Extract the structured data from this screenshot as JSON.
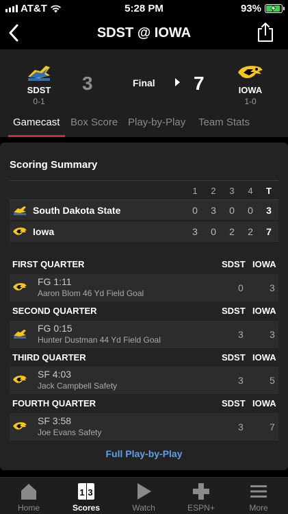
{
  "status_bar": {
    "carrier": "AT&T",
    "time": "5:28 PM",
    "battery": "93%",
    "battery_level": 0.93
  },
  "nav": {
    "title": "SDST @ IOWA"
  },
  "game": {
    "away": {
      "abbr": "SDST",
      "record": "0-1",
      "score": "3"
    },
    "home": {
      "abbr": "IOWA",
      "record": "1-0",
      "score": "7"
    },
    "status": "Final"
  },
  "tabs": [
    "Gamecast",
    "Box Score",
    "Play-by-Play",
    "Team Stats"
  ],
  "scoring_summary": {
    "title": "Scoring Summary",
    "columns": [
      "1",
      "2",
      "3",
      "4",
      "T"
    ],
    "teams": [
      {
        "name": "South Dakota State",
        "q": [
          "0",
          "3",
          "0",
          "0"
        ],
        "total": "3"
      },
      {
        "name": "Iowa",
        "q": [
          "3",
          "0",
          "2",
          "2"
        ],
        "total": "7"
      }
    ]
  },
  "quarters": [
    {
      "label": "FIRST QUARTER",
      "away": "SDST",
      "home": "IOWA",
      "play": {
        "team": "IOWA",
        "type_time": "FG  1:11",
        "desc": "Aaron Blom 46 Yd Field Goal",
        "away_score": "0",
        "home_score": "3"
      }
    },
    {
      "label": "SECOND QUARTER",
      "away": "SDST",
      "home": "IOWA",
      "play": {
        "team": "SDST",
        "type_time": "FG  0:15",
        "desc": "Hunter Dustman 44 Yd Field Goal",
        "away_score": "3",
        "home_score": "3"
      }
    },
    {
      "label": "THIRD QUARTER",
      "away": "SDST",
      "home": "IOWA",
      "play": {
        "team": "IOWA",
        "type_time": "SF  4:03",
        "desc": "Jack Campbell Safety",
        "away_score": "3",
        "home_score": "5"
      }
    },
    {
      "label": "FOURTH QUARTER",
      "away": "SDST",
      "home": "IOWA",
      "play": {
        "team": "IOWA",
        "type_time": "SF  3:58",
        "desc": "Joe Evans Safety",
        "away_score": "3",
        "home_score": "7"
      }
    }
  ],
  "full_pbp_link": "Full Play-by-Play",
  "tab_bar": [
    {
      "label": "Home",
      "icon": "home-icon"
    },
    {
      "label": "Scores",
      "icon": "scores-icon"
    },
    {
      "label": "Watch",
      "icon": "play-icon"
    },
    {
      "label": "ESPN+",
      "icon": "plus-icon"
    },
    {
      "label": "More",
      "icon": "menu-icon"
    }
  ],
  "colors": {
    "accent_red": "#c9302c",
    "link_blue": "#5f9fe5",
    "battery_green": "#3fd04a",
    "iowa_gold": "#f5c518",
    "sdst_blue": "#2e6fb5"
  }
}
